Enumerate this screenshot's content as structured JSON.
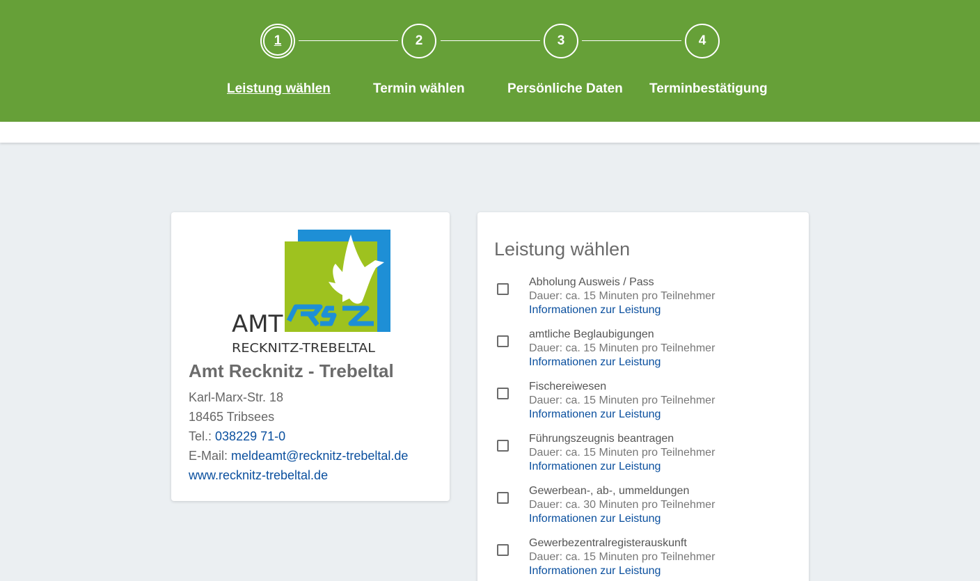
{
  "steps": [
    {
      "number": "1",
      "label": "Leistung wählen"
    },
    {
      "number": "2",
      "label": "Termin wählen"
    },
    {
      "number": "3",
      "label": "Persönliche Daten"
    },
    {
      "number": "4",
      "label": "Terminbestätigung"
    }
  ],
  "colors": {
    "header": "#66a038",
    "link": "#0a4f9e",
    "logo_blue": "#1e8fd6",
    "logo_green": "#9ec21f"
  },
  "office": {
    "logo": {
      "line1": "AMT",
      "line2": "RECKNITZ-TREBELTAL"
    },
    "name": "Amt Recknitz - Trebeltal",
    "street": "Karl-Marx-Str. 18",
    "city": "18465 Tribsees",
    "phone_label": "Tel.:",
    "phone": "038229 71-0",
    "email_label": "E-Mail:",
    "email": "meldeamt@recknitz-trebeltal.de",
    "website": "www.recknitz-trebeltal.de"
  },
  "services": {
    "title": "Leistung wählen",
    "items": [
      {
        "name": "Abholung Ausweis / Pass",
        "duration": "Dauer: ca. 15 Minuten pro Teilnehmer",
        "info": "Informationen zur Leistung"
      },
      {
        "name": "amtliche Beglaubigungen",
        "duration": "Dauer: ca. 15 Minuten pro Teilnehmer",
        "info": "Informationen zur Leistung"
      },
      {
        "name": "Fischereiwesen",
        "duration": "Dauer: ca. 15 Minuten pro Teilnehmer",
        "info": "Informationen zur Leistung"
      },
      {
        "name": "Führungszeugnis beantragen",
        "duration": "Dauer: ca. 15 Minuten pro Teilnehmer",
        "info": "Informationen zur Leistung"
      },
      {
        "name": "Gewerbean-, ab-, ummeldungen",
        "duration": "Dauer: ca. 30 Minuten pro Teilnehmer",
        "info": "Informationen zur Leistung"
      },
      {
        "name": "Gewerbezentralregisterauskunft",
        "duration": "Dauer: ca. 15 Minuten pro Teilnehmer",
        "info": "Informationen zur Leistung"
      }
    ]
  }
}
